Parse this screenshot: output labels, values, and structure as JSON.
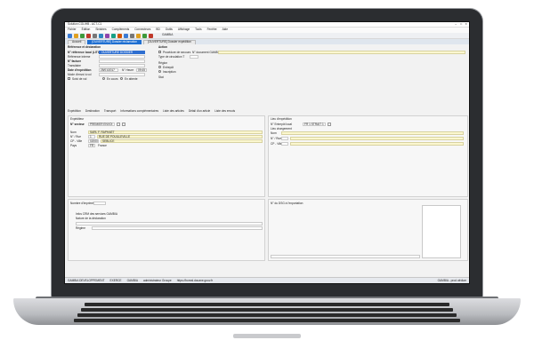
{
  "window": {
    "title": "Solution COLIHB - ACT-C1",
    "controls": [
      "–",
      "□",
      "✕"
    ]
  },
  "menu": [
    "Fichier",
    "Édition",
    "Sinistres",
    "Compléments",
    "Connecteurs",
    "BD",
    "Outils",
    "Affichage",
    "Tools",
    "Fenêtre",
    "Aide"
  ],
  "toolbar": {
    "user": "GAMBIA"
  },
  "tabs": [
    {
      "label": "Accueil"
    },
    {
      "label": "[OUVERTURE] Dossier réclamation"
    },
    {
      "label": "[OUVERTURE] Dossier expédition"
    }
  ],
  "left_top": {
    "section": "Référence et déclaration",
    "ref_label": "N° référence local (LITIS)",
    "ref_value": "OUVERTURE DOSSIER",
    "client_ref_label": "Référence interne",
    "facture_label": "N° facture",
    "transitaire_label": "Transitaire",
    "date_label": "Date d'expédition",
    "date_value": "25/01/2017",
    "heure_label": "N° Heure",
    "heure_value": "09:45",
    "mode_label": "Mode d'envoi à vol",
    "suivi_label": "Suivi de vol",
    "option_a": "En cours",
    "option_b": "En attente"
  },
  "right_top": {
    "section": "Action",
    "chk1": "Procédure de secours",
    "num_label": "N° document GAMBIA",
    "type_label": "Type de circulation T",
    "region_label": "Région",
    "radio1": "Entrepôt",
    "radio2": "Inscription",
    "stat_label": "Stat"
  },
  "subtabs": [
    "Expédition",
    "Destination",
    "Transport",
    "Informations complémentaires",
    "Liste des articles",
    "Détail d'un article",
    "Liste des envois"
  ],
  "expediteur": {
    "section": "Expéditeur",
    "code_label": "N° secteur",
    "code_value": "PREMIER ENVOI",
    "nom_label": "Nom",
    "nom_value": "SARL F. RAPHAËT",
    "rue_label": "N° / Rue",
    "rue_num": "1",
    "rue_value": "RUE DE POUILLEVILLE",
    "cp_label": "CP - Ville",
    "cp_value": "02000",
    "ville_value": "SEBLICE",
    "pays_label": "Pays",
    "pays_code": "FR",
    "pays_value": "France"
  },
  "destination": {
    "section": "Lieu d'expédition",
    "code_label": "N° Entrepôt local",
    "code_value": "FR 1 STRAIT 1",
    "lieu_label": "Lieu chargement",
    "nom_label": "Nom",
    "rue_label": "N° / Rue",
    "cp_label": "CP - Ville"
  },
  "bottom_left": {
    "num_label": "Nombre d'Imprimés",
    "info_label": "Infos CRM des services GAMBIA",
    "type_label": "Nature de la déclaration",
    "regime_label": "Régime"
  },
  "bottom_right": {
    "section": "N° du DSG à l'exportation"
  },
  "status": {
    "company": "GAMBIA DEVELOPPEMENT",
    "env": "EXERCE",
    "user": "GAMBIA",
    "group": "administrateur Groupe",
    "url": "https://boreal.douane.gouv.fr",
    "right": "GAMBIA - prod ofrdiarr"
  }
}
